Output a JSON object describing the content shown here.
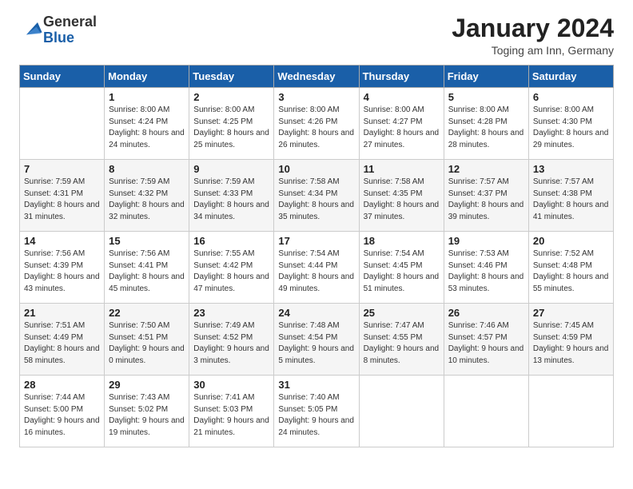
{
  "header": {
    "logo": {
      "general": "General",
      "blue": "Blue"
    },
    "title": "January 2024",
    "location": "Toging am Inn, Germany"
  },
  "days_of_week": [
    "Sunday",
    "Monday",
    "Tuesday",
    "Wednesday",
    "Thursday",
    "Friday",
    "Saturday"
  ],
  "weeks": [
    [
      {
        "day": "",
        "info": ""
      },
      {
        "day": "1",
        "info": "Sunrise: 8:00 AM\nSunset: 4:24 PM\nDaylight: 8 hours\nand 24 minutes."
      },
      {
        "day": "2",
        "info": "Sunrise: 8:00 AM\nSunset: 4:25 PM\nDaylight: 8 hours\nand 25 minutes."
      },
      {
        "day": "3",
        "info": "Sunrise: 8:00 AM\nSunset: 4:26 PM\nDaylight: 8 hours\nand 26 minutes."
      },
      {
        "day": "4",
        "info": "Sunrise: 8:00 AM\nSunset: 4:27 PM\nDaylight: 8 hours\nand 27 minutes."
      },
      {
        "day": "5",
        "info": "Sunrise: 8:00 AM\nSunset: 4:28 PM\nDaylight: 8 hours\nand 28 minutes."
      },
      {
        "day": "6",
        "info": "Sunrise: 8:00 AM\nSunset: 4:30 PM\nDaylight: 8 hours\nand 29 minutes."
      }
    ],
    [
      {
        "day": "7",
        "info": "Sunrise: 7:59 AM\nSunset: 4:31 PM\nDaylight: 8 hours\nand 31 minutes."
      },
      {
        "day": "8",
        "info": "Sunrise: 7:59 AM\nSunset: 4:32 PM\nDaylight: 8 hours\nand 32 minutes."
      },
      {
        "day": "9",
        "info": "Sunrise: 7:59 AM\nSunset: 4:33 PM\nDaylight: 8 hours\nand 34 minutes."
      },
      {
        "day": "10",
        "info": "Sunrise: 7:58 AM\nSunset: 4:34 PM\nDaylight: 8 hours\nand 35 minutes."
      },
      {
        "day": "11",
        "info": "Sunrise: 7:58 AM\nSunset: 4:35 PM\nDaylight: 8 hours\nand 37 minutes."
      },
      {
        "day": "12",
        "info": "Sunrise: 7:57 AM\nSunset: 4:37 PM\nDaylight: 8 hours\nand 39 minutes."
      },
      {
        "day": "13",
        "info": "Sunrise: 7:57 AM\nSunset: 4:38 PM\nDaylight: 8 hours\nand 41 minutes."
      }
    ],
    [
      {
        "day": "14",
        "info": "Sunrise: 7:56 AM\nSunset: 4:39 PM\nDaylight: 8 hours\nand 43 minutes."
      },
      {
        "day": "15",
        "info": "Sunrise: 7:56 AM\nSunset: 4:41 PM\nDaylight: 8 hours\nand 45 minutes."
      },
      {
        "day": "16",
        "info": "Sunrise: 7:55 AM\nSunset: 4:42 PM\nDaylight: 8 hours\nand 47 minutes."
      },
      {
        "day": "17",
        "info": "Sunrise: 7:54 AM\nSunset: 4:44 PM\nDaylight: 8 hours\nand 49 minutes."
      },
      {
        "day": "18",
        "info": "Sunrise: 7:54 AM\nSunset: 4:45 PM\nDaylight: 8 hours\nand 51 minutes."
      },
      {
        "day": "19",
        "info": "Sunrise: 7:53 AM\nSunset: 4:46 PM\nDaylight: 8 hours\nand 53 minutes."
      },
      {
        "day": "20",
        "info": "Sunrise: 7:52 AM\nSunset: 4:48 PM\nDaylight: 8 hours\nand 55 minutes."
      }
    ],
    [
      {
        "day": "21",
        "info": "Sunrise: 7:51 AM\nSunset: 4:49 PM\nDaylight: 8 hours\nand 58 minutes."
      },
      {
        "day": "22",
        "info": "Sunrise: 7:50 AM\nSunset: 4:51 PM\nDaylight: 9 hours\nand 0 minutes."
      },
      {
        "day": "23",
        "info": "Sunrise: 7:49 AM\nSunset: 4:52 PM\nDaylight: 9 hours\nand 3 minutes."
      },
      {
        "day": "24",
        "info": "Sunrise: 7:48 AM\nSunset: 4:54 PM\nDaylight: 9 hours\nand 5 minutes."
      },
      {
        "day": "25",
        "info": "Sunrise: 7:47 AM\nSunset: 4:55 PM\nDaylight: 9 hours\nand 8 minutes."
      },
      {
        "day": "26",
        "info": "Sunrise: 7:46 AM\nSunset: 4:57 PM\nDaylight: 9 hours\nand 10 minutes."
      },
      {
        "day": "27",
        "info": "Sunrise: 7:45 AM\nSunset: 4:59 PM\nDaylight: 9 hours\nand 13 minutes."
      }
    ],
    [
      {
        "day": "28",
        "info": "Sunrise: 7:44 AM\nSunset: 5:00 PM\nDaylight: 9 hours\nand 16 minutes."
      },
      {
        "day": "29",
        "info": "Sunrise: 7:43 AM\nSunset: 5:02 PM\nDaylight: 9 hours\nand 19 minutes."
      },
      {
        "day": "30",
        "info": "Sunrise: 7:41 AM\nSunset: 5:03 PM\nDaylight: 9 hours\nand 21 minutes."
      },
      {
        "day": "31",
        "info": "Sunrise: 7:40 AM\nSunset: 5:05 PM\nDaylight: 9 hours\nand 24 minutes."
      },
      {
        "day": "",
        "info": ""
      },
      {
        "day": "",
        "info": ""
      },
      {
        "day": "",
        "info": ""
      }
    ]
  ]
}
